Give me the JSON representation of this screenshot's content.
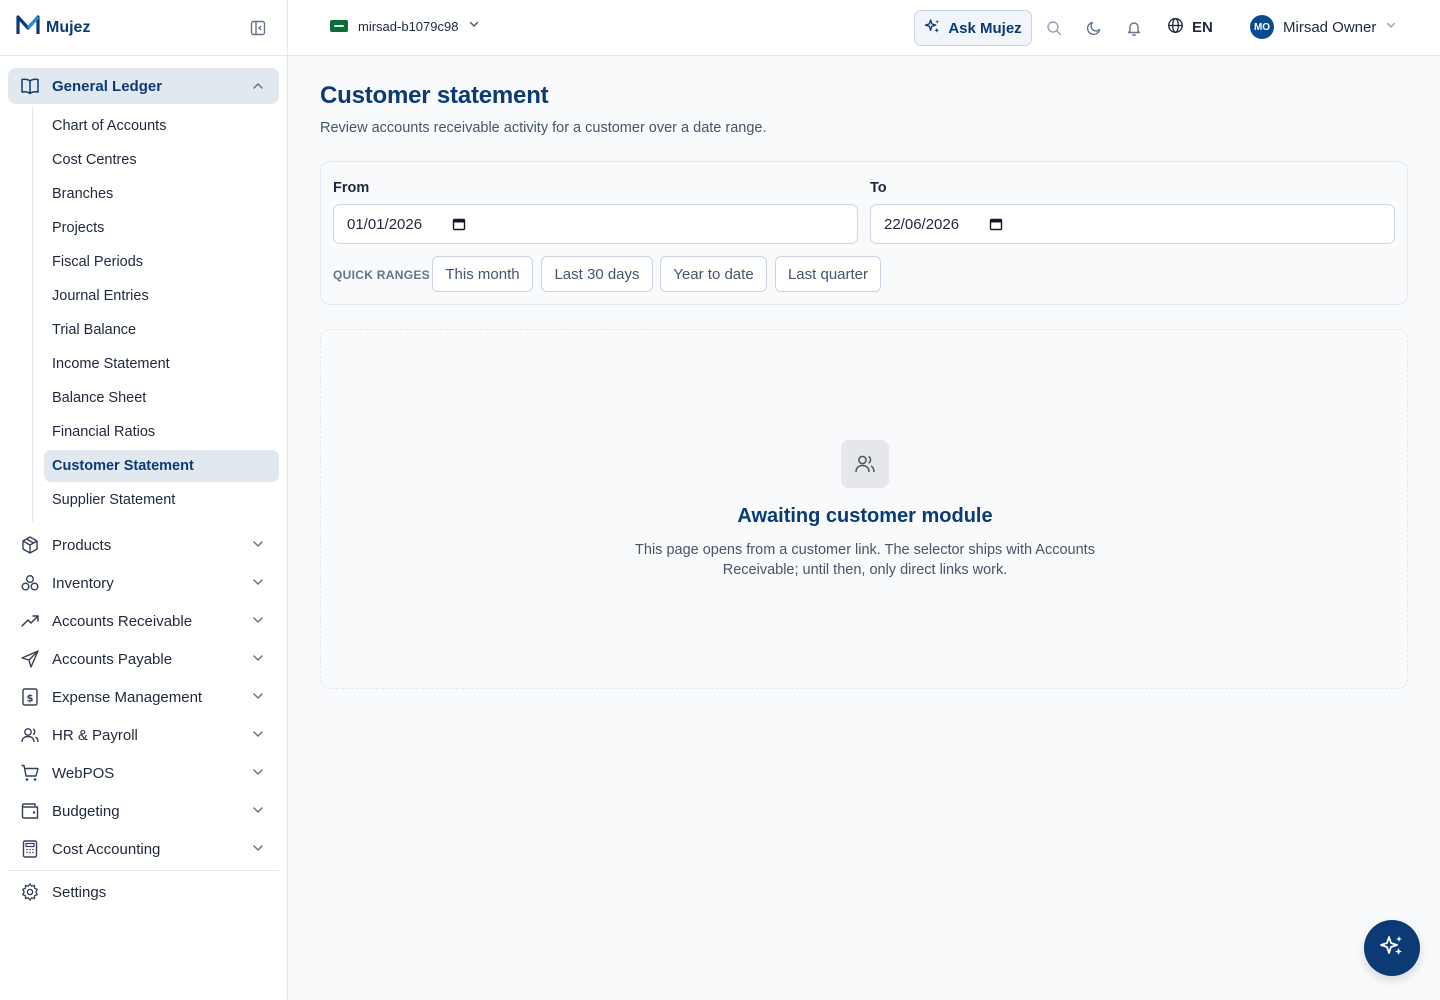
{
  "brand": {
    "name": "Mujez",
    "logo_icon": "mujez-logo-icon",
    "collapse_icon": "sidebar-collapse-icon"
  },
  "sidebar": {
    "general_ledger": {
      "label": "General Ledger",
      "icon": "book-icon",
      "items": [
        {
          "label": "Chart of Accounts"
        },
        {
          "label": "Cost Centres"
        },
        {
          "label": "Branches"
        },
        {
          "label": "Projects"
        },
        {
          "label": "Fiscal Periods"
        },
        {
          "label": "Journal Entries"
        },
        {
          "label": "Trial Balance"
        },
        {
          "label": "Income Statement"
        },
        {
          "label": "Balance Sheet"
        },
        {
          "label": "Financial Ratios"
        },
        {
          "label": "Customer Statement",
          "active": true
        },
        {
          "label": "Supplier Statement"
        }
      ]
    },
    "groups": [
      {
        "label": "Products",
        "icon": "package-icon"
      },
      {
        "label": "Inventory",
        "icon": "boxes-icon"
      },
      {
        "label": "Accounts Receivable",
        "icon": "trending-up-icon"
      },
      {
        "label": "Accounts Payable",
        "icon": "send-icon"
      },
      {
        "label": "Expense Management",
        "icon": "dollar-receipt-icon"
      },
      {
        "label": "HR & Payroll",
        "icon": "users-icon"
      },
      {
        "label": "WebPOS",
        "icon": "cart-icon"
      },
      {
        "label": "Budgeting",
        "icon": "wallet-icon"
      },
      {
        "label": "Cost Accounting",
        "icon": "calculator-icon"
      }
    ],
    "settings": {
      "label": "Settings",
      "icon": "gear-icon"
    }
  },
  "topbar": {
    "org_name": "mirsad-b1079c98",
    "ask_label": "Ask Mujez",
    "language": "EN",
    "user_initials": "MO",
    "user_name": "Mirsad Owner"
  },
  "page": {
    "title": "Customer statement",
    "subtitle": "Review accounts receivable activity for a customer over a date range."
  },
  "filters": {
    "from_label": "From",
    "from_value": "01/01/2026",
    "to_label": "To",
    "to_value": "22/06/2026",
    "quick_ranges_label": "QUICK RANGES",
    "quick_ranges": [
      "This month",
      "Last 30 days",
      "Year to date",
      "Last quarter"
    ]
  },
  "empty_state": {
    "icon": "users-icon",
    "title": "Awaiting customer module",
    "description": "This page opens from a customer link. The selector ships with Accounts Receivable; until then, only direct links work."
  },
  "colors": {
    "primary": "#0b3a75",
    "active_bg": "#e2e8f0",
    "border": "#e5e7eb"
  }
}
